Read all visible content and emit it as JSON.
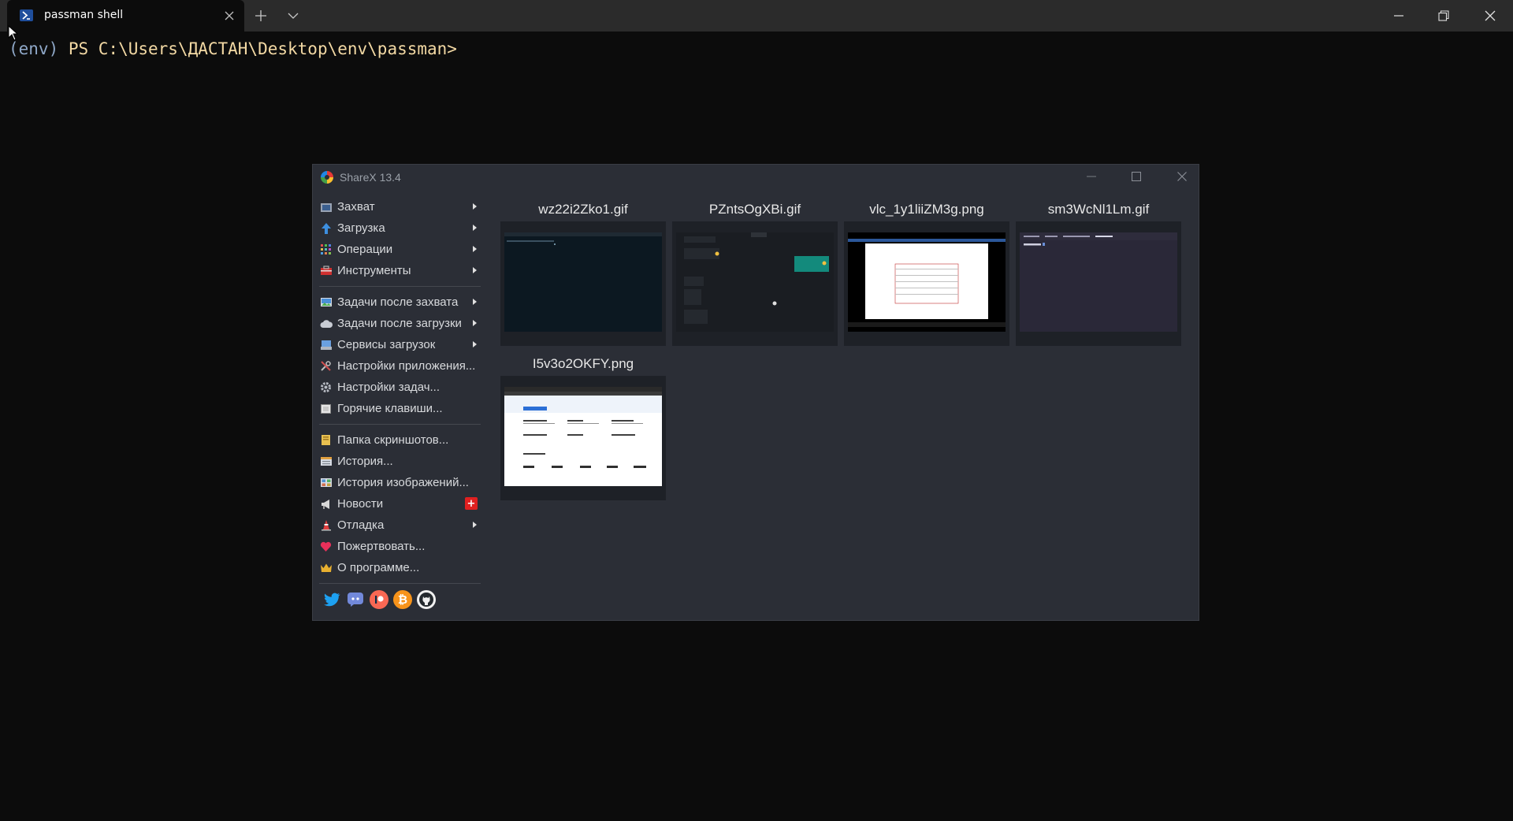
{
  "terminal": {
    "tab_title": "passman shell",
    "prompt_env": "(env)",
    "prompt_path": " PS C:\\Users\\ДАСТАН\\Desktop\\env\\passman>"
  },
  "sharex": {
    "title": "ShareX 13.4",
    "menu": {
      "group1": [
        {
          "label": "Захват",
          "icon": "camera-icon",
          "submenu": true
        },
        {
          "label": "Загрузка",
          "icon": "upload-arrow-icon",
          "submenu": true
        },
        {
          "label": "Операции",
          "icon": "grid-icon",
          "submenu": true
        },
        {
          "label": "Инструменты",
          "icon": "toolbox-icon",
          "submenu": true
        }
      ],
      "group2": [
        {
          "label": "Задачи после захвата",
          "icon": "image-icon",
          "submenu": true
        },
        {
          "label": "Задачи после загрузки",
          "icon": "cloud-icon",
          "submenu": true
        },
        {
          "label": "Сервисы загрузок",
          "icon": "server-icon",
          "submenu": true
        },
        {
          "label": "Настройки приложения...",
          "icon": "wrench-icon",
          "submenu": false
        },
        {
          "label": "Настройки задач...",
          "icon": "gear-icon",
          "submenu": false
        },
        {
          "label": "Горячие клавиши...",
          "icon": "keyboard-icon",
          "submenu": false
        }
      ],
      "group3": [
        {
          "label": "Папка скриншотов...",
          "icon": "folder-icon",
          "submenu": false
        },
        {
          "label": "История...",
          "icon": "history-icon",
          "submenu": false
        },
        {
          "label": "История изображений...",
          "icon": "image-history-icon",
          "submenu": false
        },
        {
          "label": "Новости",
          "icon": "megaphone-icon",
          "submenu": false,
          "badge": "+"
        },
        {
          "label": "Отладка",
          "icon": "traffic-cone-icon",
          "submenu": true
        },
        {
          "label": "Пожертвовать...",
          "icon": "heart-icon",
          "submenu": false
        },
        {
          "label": "О программе...",
          "icon": "crown-icon",
          "submenu": false
        }
      ]
    },
    "social": [
      "twitter-icon",
      "discord-icon",
      "patreon-icon",
      "bitcoin-icon",
      "github-icon"
    ],
    "thumbnails": [
      {
        "name": "wz22i2Zko1.gif"
      },
      {
        "name": "PZntsOgXBi.gif"
      },
      {
        "name": "vlc_1y1liiZM3g.png"
      },
      {
        "name": "sm3WcNl1Lm.gif"
      },
      {
        "name": "I5v3o2OKFY.png"
      }
    ]
  },
  "colors": {
    "terminal_bg": "#0c0c0c",
    "titlebar_bg": "#2b2b2b",
    "sharex_bg": "#2b2e36",
    "prompt_path": "#f3d9a4",
    "prompt_env": "#8fa8c8"
  }
}
